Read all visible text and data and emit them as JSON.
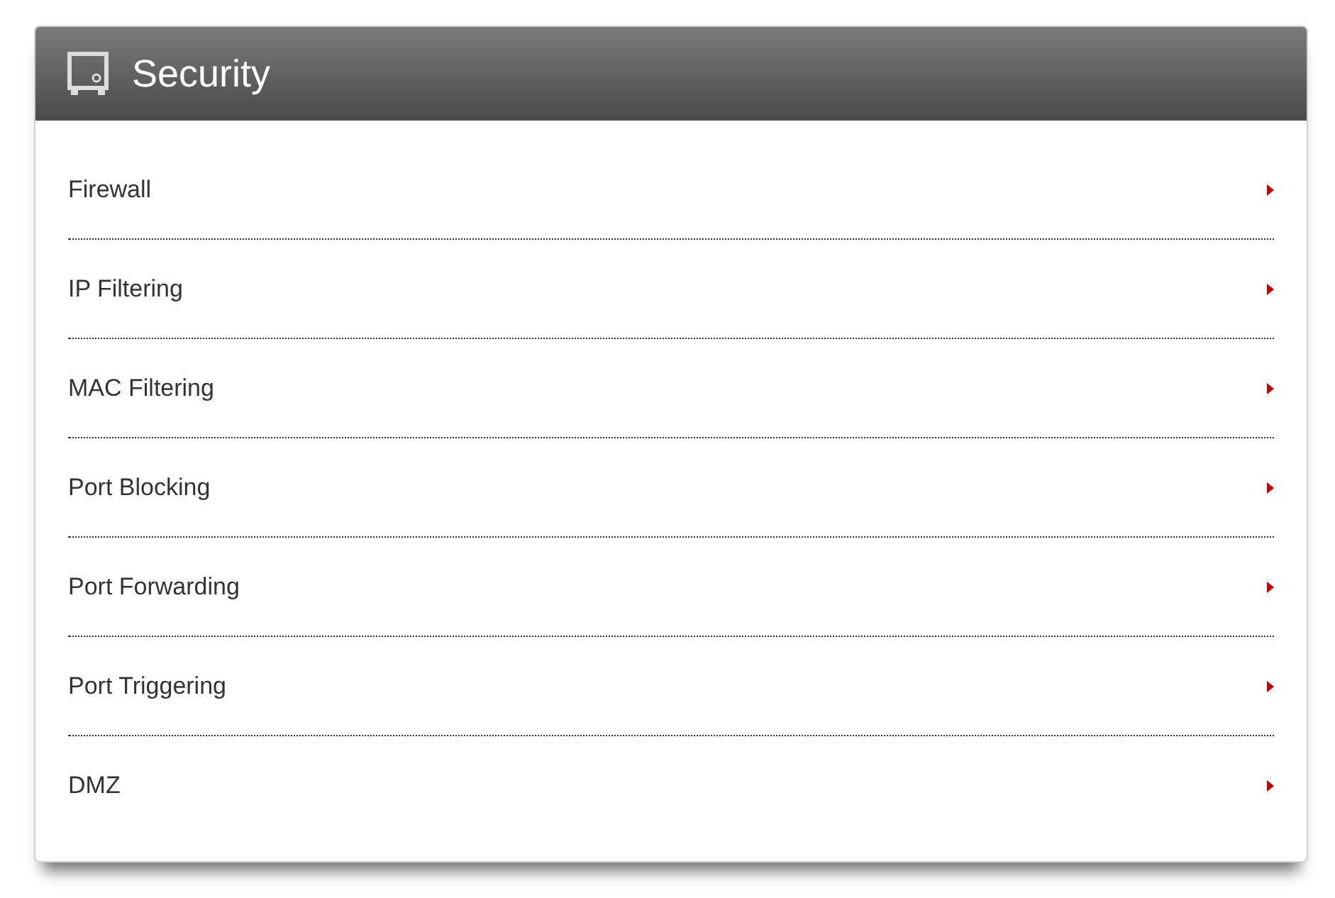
{
  "panel": {
    "title": "Security"
  },
  "menu": [
    {
      "label": "Firewall"
    },
    {
      "label": "IP Filtering"
    },
    {
      "label": "MAC Filtering"
    },
    {
      "label": "Port Blocking"
    },
    {
      "label": "Port Forwarding"
    },
    {
      "label": "Port Triggering"
    },
    {
      "label": "DMZ"
    }
  ]
}
